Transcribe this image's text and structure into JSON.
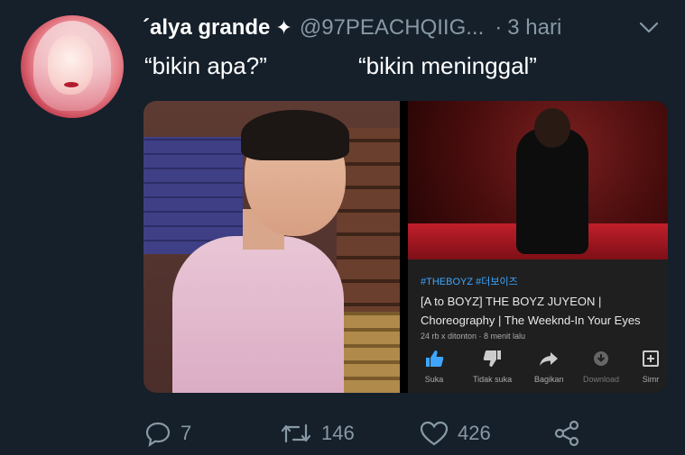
{
  "tweet": {
    "display_name": "´alya grande",
    "verified_glyph": "✦",
    "handle": "@97PEACHQIIG...",
    "separator": "·",
    "time": "3 hari",
    "text": "“bikin apa?”              “bikin meninggal”",
    "icons": {
      "more": "chevron-down-icon"
    }
  },
  "embedded_video": {
    "hashtags": "#THEBOYZ #더보이즈",
    "title_line1": "[A to BOYZ] THE BOYZ JUYEON |",
    "title_line2": "Choreography | The Weeknd-In Your Eyes",
    "meta": "24 rb x ditonton · 8 menit lalu",
    "actions": [
      {
        "label": "Suka",
        "icon": "thumbs-up-icon"
      },
      {
        "label": "Tidak suka",
        "icon": "thumbs-down-icon"
      },
      {
        "label": "Bagikan",
        "icon": "share-icon"
      },
      {
        "label": "Download",
        "icon": "download-icon"
      },
      {
        "label": "Simr",
        "icon": "add-to-playlist-icon"
      }
    ],
    "colors": {
      "tag": "#3ea6ff",
      "active": "#3ea6ff"
    }
  },
  "tweet_actions": {
    "replies": "7",
    "retweets": "146",
    "likes": "426",
    "icons": [
      "reply-icon",
      "retweet-icon",
      "like-icon",
      "share-icon"
    ]
  },
  "colors": {
    "background": "#15202b",
    "secondary_text": "#8899a6",
    "primary_text": "#ffffff"
  }
}
